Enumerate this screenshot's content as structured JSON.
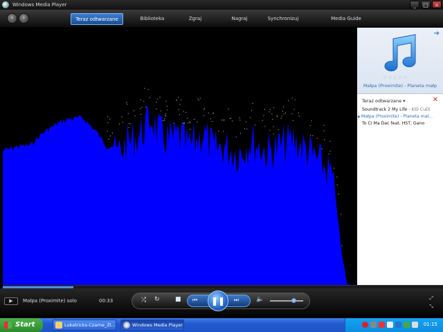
{
  "window": {
    "title": "Windows Media Player"
  },
  "nav": {
    "tabs": [
      {
        "label": "Teraz odtwarzane",
        "active": true
      },
      {
        "label": "Biblioteka"
      },
      {
        "label": "Zgraj"
      },
      {
        "label": "Nagraj"
      },
      {
        "label": "Synchronizuj"
      },
      {
        "label": "Media Guide"
      }
    ]
  },
  "panel": {
    "album_info": "Małpa (Proximite) - Planeta małp",
    "rating_stars": "☆☆☆☆☆",
    "playlist_title": "Teraz odtwarzane",
    "items": [
      {
        "title": "Soundtrack 2 My Life",
        "artist": " - KiD CuDi"
      },
      {
        "title": "Małpa (Proximite)",
        "artist": " - Planeta mał..."
      },
      {
        "title": "To Ci Ma Dac feat. HST, Gano",
        "artist": ""
      }
    ]
  },
  "player": {
    "now_playing": "Małpa (Proximite) solo",
    "time": "00:33",
    "progress": 0.16,
    "volume": 0.7
  },
  "taskbar": {
    "start_label": "Start",
    "tasks": [
      {
        "label": "Lukatricks-Czarne_Zl..."
      },
      {
        "label": "Windows Media Player"
      }
    ],
    "clock": "01:15"
  },
  "colors": {
    "viz_fill": "#0000ff",
    "accent": "#2f6bb0",
    "taskbar": "#245edb",
    "start": "#3c9a3c"
  }
}
